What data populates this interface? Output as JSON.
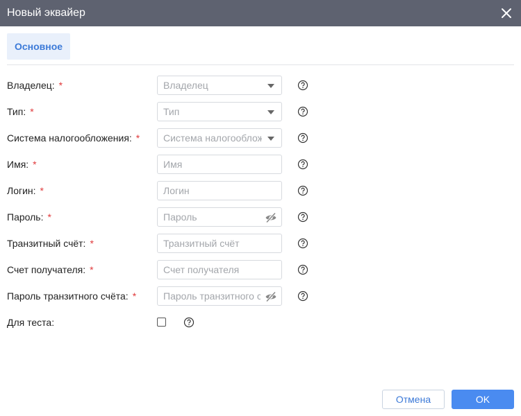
{
  "dialog": {
    "title": "Новый эквайер",
    "close_icon": "close-icon"
  },
  "tabs": [
    {
      "label": "Основное",
      "active": true
    }
  ],
  "form": {
    "owner": {
      "label": "Владелец:",
      "required": "*",
      "placeholder": "Владелец",
      "value": ""
    },
    "type": {
      "label": "Тип:",
      "required": "*",
      "placeholder": "Тип",
      "value": ""
    },
    "tax": {
      "label": "Система налогообложения:",
      "required": "*",
      "placeholder": "Система налогообложения",
      "value": ""
    },
    "name": {
      "label": "Имя:",
      "required": "*",
      "placeholder": "Имя",
      "value": ""
    },
    "login": {
      "label": "Логин:",
      "required": "*",
      "placeholder": "Логин",
      "value": ""
    },
    "password": {
      "label": "Пароль:",
      "required": "*",
      "placeholder": "Пароль",
      "value": ""
    },
    "transit_account": {
      "label": "Транзитный счёт:",
      "required": "*",
      "placeholder": "Транзитный счёт",
      "value": ""
    },
    "recipient_account": {
      "label": "Счет получателя:",
      "required": "*",
      "placeholder": "Счет получателя",
      "value": ""
    },
    "transit_password": {
      "label": "Пароль транзитного счёта:",
      "required": "*",
      "placeholder": "Пароль транзитного счёта",
      "value": ""
    },
    "test": {
      "label": "Для теста:",
      "checked": false
    }
  },
  "footer": {
    "cancel_label": "Отмена",
    "ok_label": "OK"
  },
  "colors": {
    "titlebar": "#5e6270",
    "accent": "#4a8bf0",
    "required": "#e0393b",
    "tab_bg": "#e9f0fb"
  }
}
